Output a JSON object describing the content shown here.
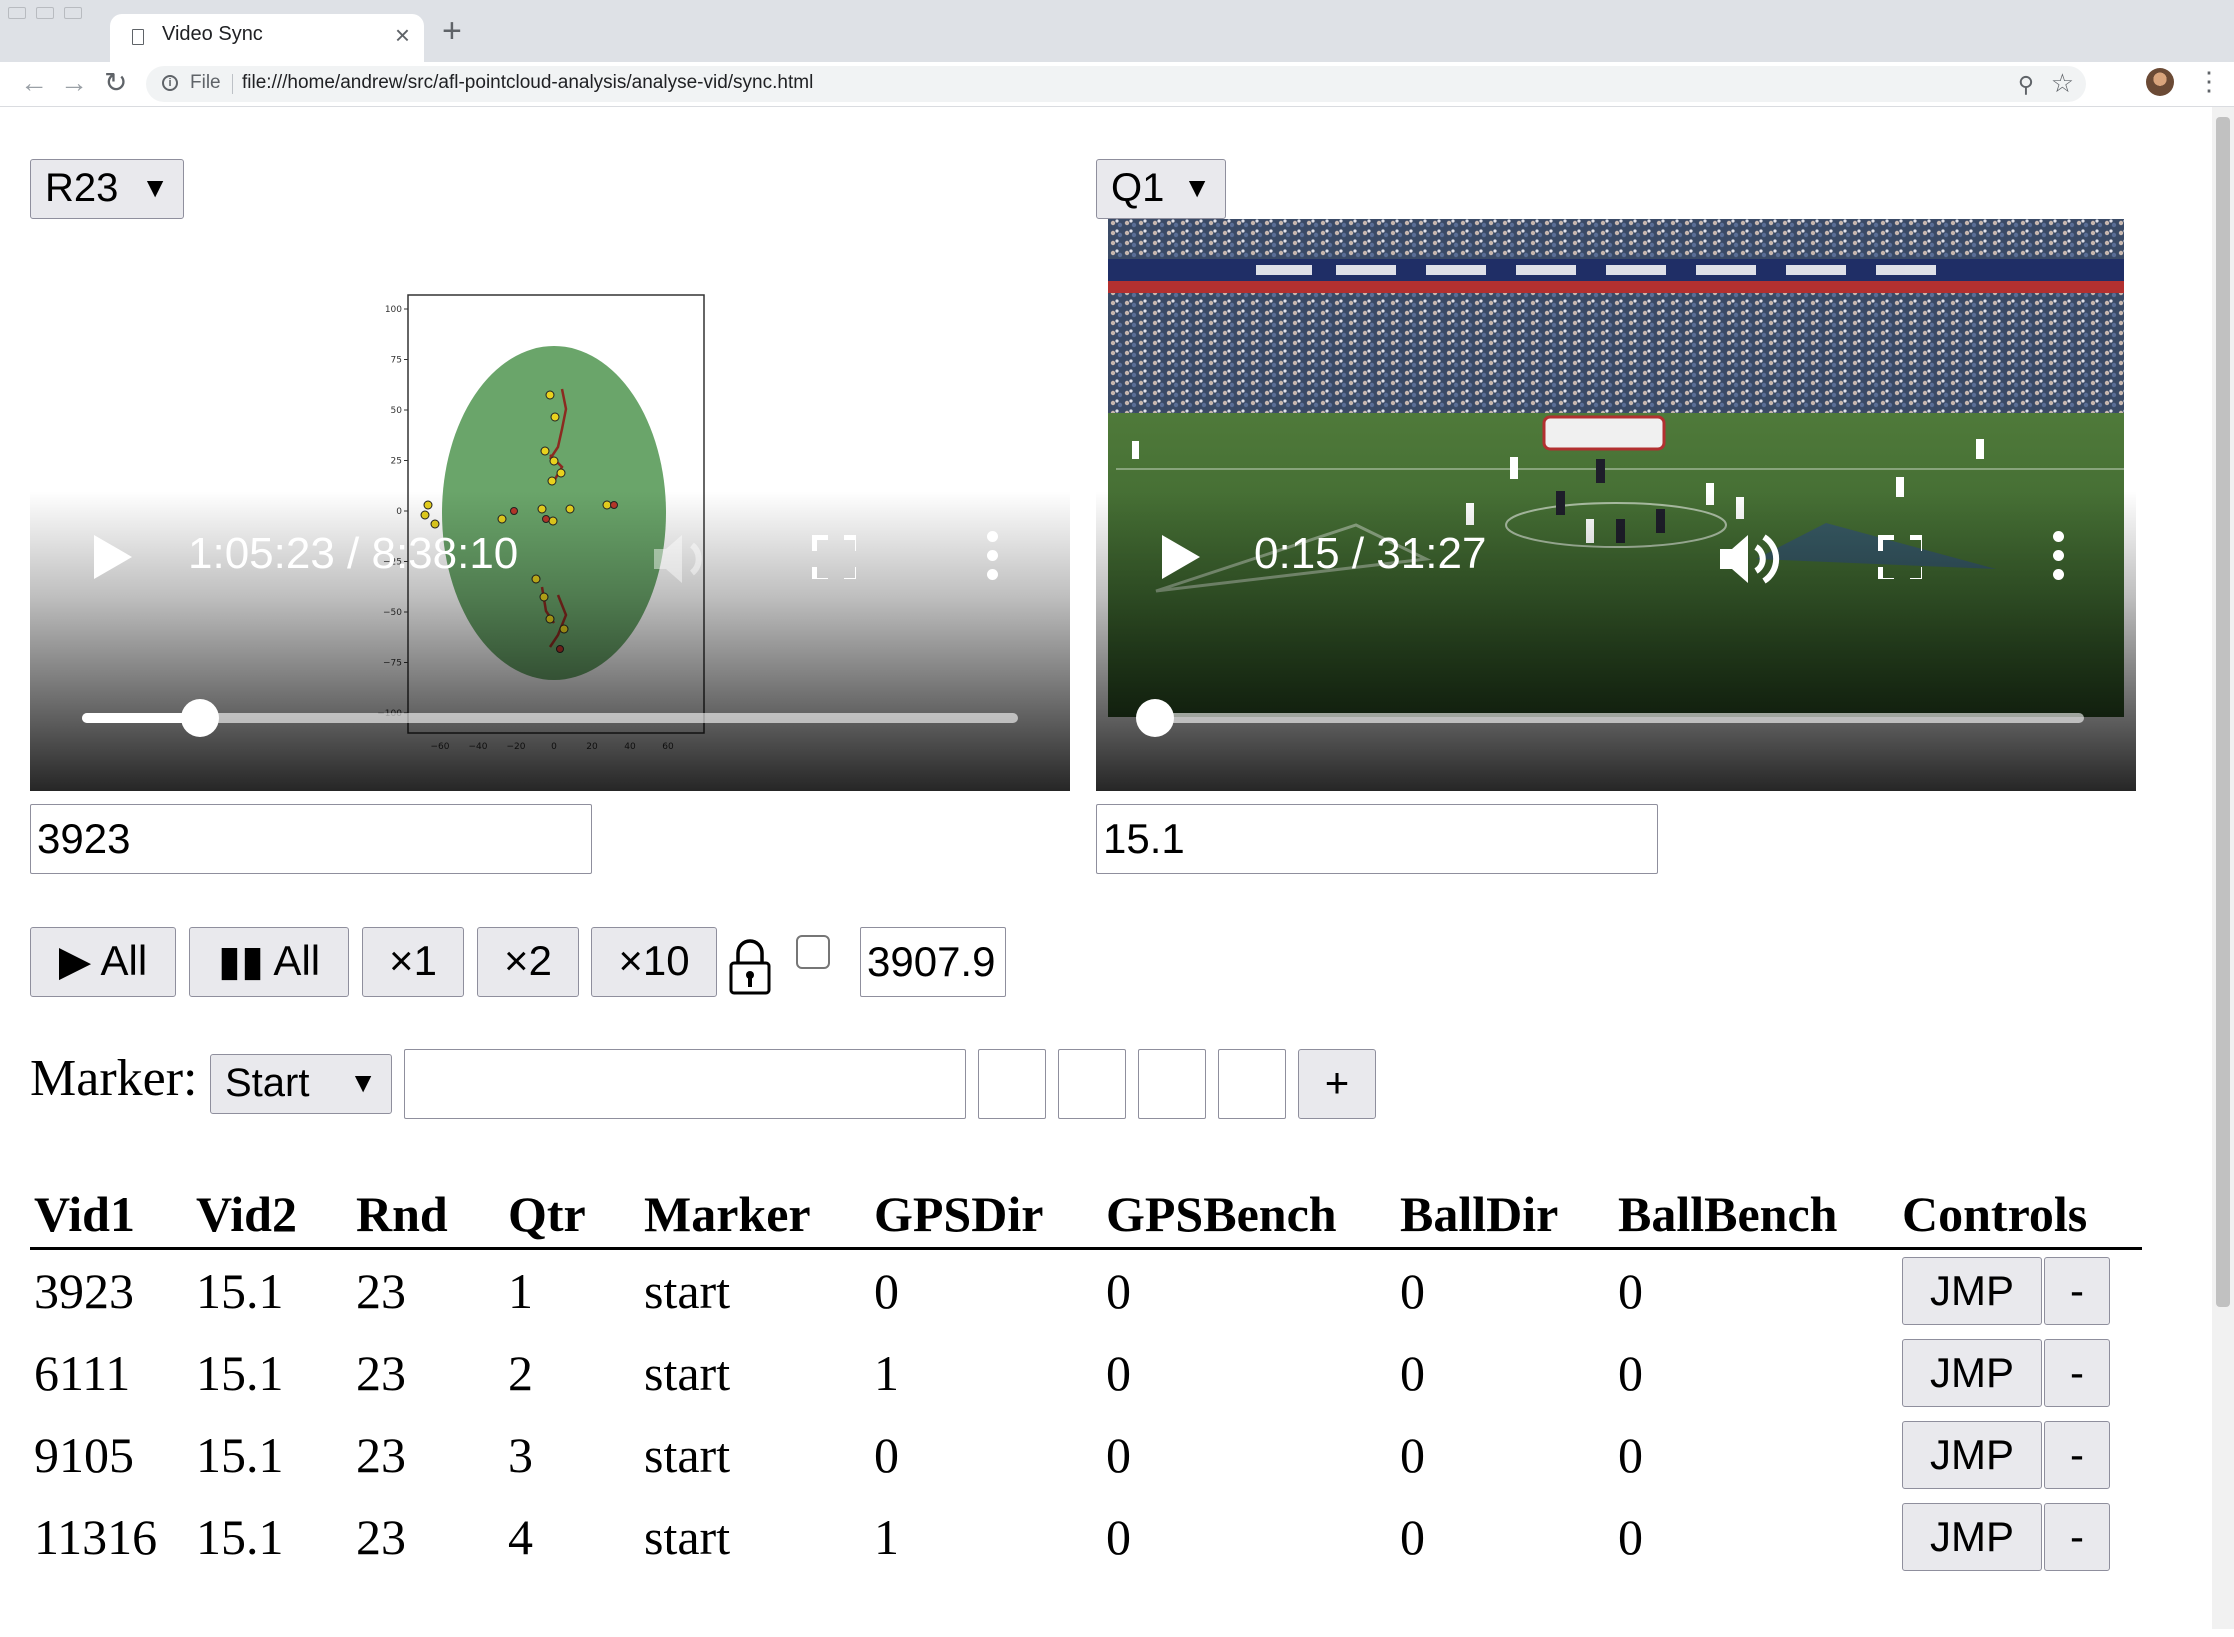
{
  "browser": {
    "tab_title": "Video Sync",
    "tab_close": "×",
    "new_tab": "+",
    "scheme_label": "File",
    "url": "file:///home/andrew/src/afl-pointcloud-analysis/analyse-vid/sync.html",
    "icons": {
      "back": "arrow-left-icon",
      "forward": "arrow-right-icon",
      "reload": "reload-icon",
      "info": "info-icon",
      "zoom": "zoom-icon",
      "bookmark": "star-icon",
      "menu": "kebab-menu-icon"
    }
  },
  "left": {
    "select_value": "R23",
    "video": {
      "time": "1:05:23 / 8:38:10",
      "progress": 0.126,
      "muted_appearance": true
    },
    "input_value": "3923"
  },
  "right": {
    "select_value": "Q1",
    "video": {
      "time": "0:15 / 31:27",
      "progress": 0.008,
      "muted_appearance": false
    },
    "input_value": "15.1"
  },
  "controls": {
    "play_all": "▶ All",
    "pause_all": "▮▮ All",
    "speed_1": "×1",
    "speed_2": "×2",
    "speed_10": "×10",
    "lock_icon": "lock-icon",
    "offset_value": "3907.9"
  },
  "marker": {
    "label": "Marker:",
    "select_value": "Start",
    "text_value": "",
    "add_label": "+"
  },
  "table": {
    "headers": [
      "Vid1",
      "Vid2",
      "Rnd",
      "Qtr",
      "Marker",
      "GPSDir",
      "GPSBench",
      "BallDir",
      "BallBench",
      "Controls"
    ],
    "jump_label": "JMP",
    "delete_label": "-",
    "rows": [
      [
        "3923",
        "15.1",
        "23",
        "1",
        "start",
        "0",
        "0",
        "0",
        "0"
      ],
      [
        "6111",
        "15.1",
        "23",
        "2",
        "start",
        "1",
        "0",
        "0",
        "0"
      ],
      [
        "9105",
        "15.1",
        "23",
        "3",
        "start",
        "0",
        "0",
        "0",
        "0"
      ],
      [
        "11316",
        "15.1",
        "23",
        "4",
        "start",
        "1",
        "0",
        "0",
        "0"
      ]
    ]
  },
  "colors": {
    "pitch_green": "#6aa56a",
    "player_yellow": "#e8d21e",
    "player_red": "#b8372a",
    "stadium_grass": "#3e6b2f"
  },
  "plot": {
    "y_ticks": [
      "100",
      "75",
      "50",
      "25",
      "0",
      "−25",
      "−50",
      "−75",
      "−100"
    ],
    "x_ticks": [
      "−60",
      "−40",
      "−20",
      "0",
      "20",
      "40",
      "60"
    ]
  }
}
